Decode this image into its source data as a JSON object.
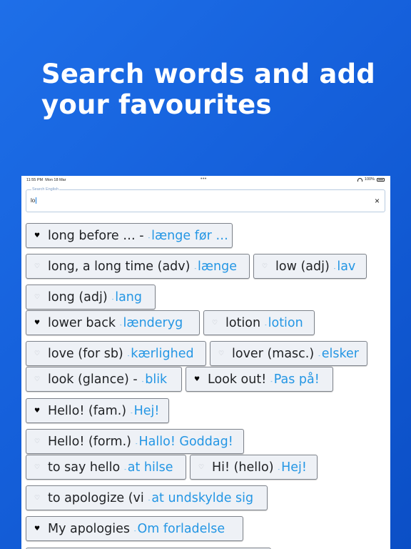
{
  "headline": "Search words and add your favourites",
  "statusbar": {
    "time": "11:55 PM",
    "date": "Mon 18 Mar",
    "dots": "•••",
    "battery": "100%"
  },
  "search": {
    "label": "Search English",
    "value": "lo",
    "clear_icon": "×"
  },
  "favourite_icon": "♥",
  "not_favourite_icon": "♡",
  "sep": "-",
  "entries": [
    {
      "en": "long before … -",
      "da": "længe før …",
      "fav": true
    },
    {
      "en": "long, a long time (adv)",
      "da": "længe",
      "fav": false
    },
    {
      "en": "low (adj)",
      "da": "lav",
      "fav": false
    },
    {
      "en": "long (adj)",
      "da": "lang",
      "fav": false
    },
    {
      "en": "lower back",
      "da": "lænderyg",
      "fav": true
    },
    {
      "en": "lotion",
      "da": "lotion",
      "fav": false
    },
    {
      "en": "love (for sb)",
      "da": "kærlighed",
      "fav": false
    },
    {
      "en": "lover (masc.)",
      "da": "elsker",
      "fav": false
    },
    {
      "en": "look (glance) -",
      "da": "blik",
      "fav": false
    },
    {
      "en": "Look out!",
      "da": "Pas på!",
      "fav": true
    },
    {
      "en": "Hello! (fam.)",
      "da": "Hej!",
      "fav": true
    },
    {
      "en": "Hello! (form.)",
      "da": "Hallo! Goddag!",
      "fav": false
    },
    {
      "en": "to say hello",
      "da": "at hilse",
      "fav": false
    },
    {
      "en": "Hi! (hello)",
      "da": "Hej!",
      "fav": false
    },
    {
      "en": "to apologize (vi",
      "da": "at undskylde sig",
      "fav": false
    },
    {
      "en": "My apologies",
      "da": "Om forladelse",
      "fav": true
    }
  ],
  "colors": {
    "background": "#1560db",
    "heart_active": "#e0272c",
    "danish_text": "#2496e4"
  }
}
